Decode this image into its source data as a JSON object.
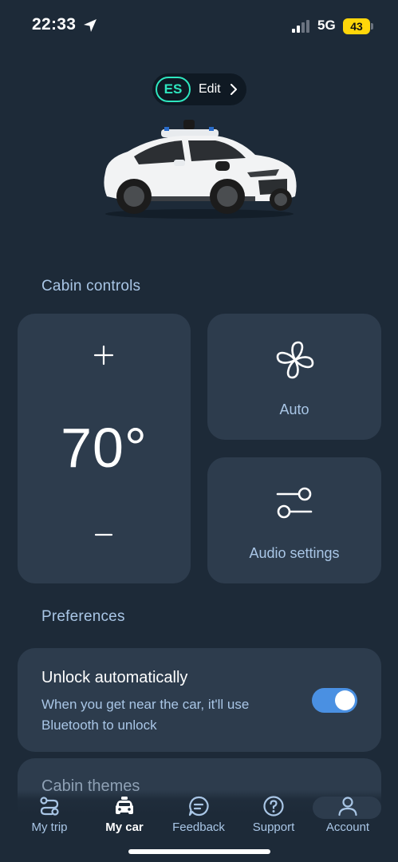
{
  "status_bar": {
    "time": "22:33",
    "network": "5G",
    "battery": "43",
    "battery_color": "#ffd60a"
  },
  "rider": {
    "initials": "ES",
    "edit_label": "Edit",
    "accent_color": "#2ee6bf"
  },
  "car": {
    "icon": "car-image"
  },
  "cabin_controls": {
    "title": "Cabin controls",
    "temperature": {
      "value": "70°",
      "increase_icon": "plus-icon",
      "decrease_icon": "minus-icon"
    },
    "fan": {
      "label": "Auto",
      "icon": "fan-icon"
    },
    "audio": {
      "label": "Audio settings",
      "icon": "sliders-icon"
    }
  },
  "preferences": {
    "title": "Preferences",
    "unlock": {
      "title": "Unlock automatically",
      "description": "When you get near the car, it'll use Bluetooth to unlock",
      "enabled": true,
      "toggle_color": "#4a90e2"
    },
    "themes": {
      "title": "Cabin themes"
    }
  },
  "bottom_nav": {
    "items": [
      {
        "label": "My trip",
        "icon": "route-icon"
      },
      {
        "label": "My car",
        "icon": "car-icon",
        "active": true
      },
      {
        "label": "Feedback",
        "icon": "chat-icon"
      },
      {
        "label": "Support",
        "icon": "help-icon"
      },
      {
        "label": "Account",
        "icon": "person-icon"
      }
    ]
  }
}
